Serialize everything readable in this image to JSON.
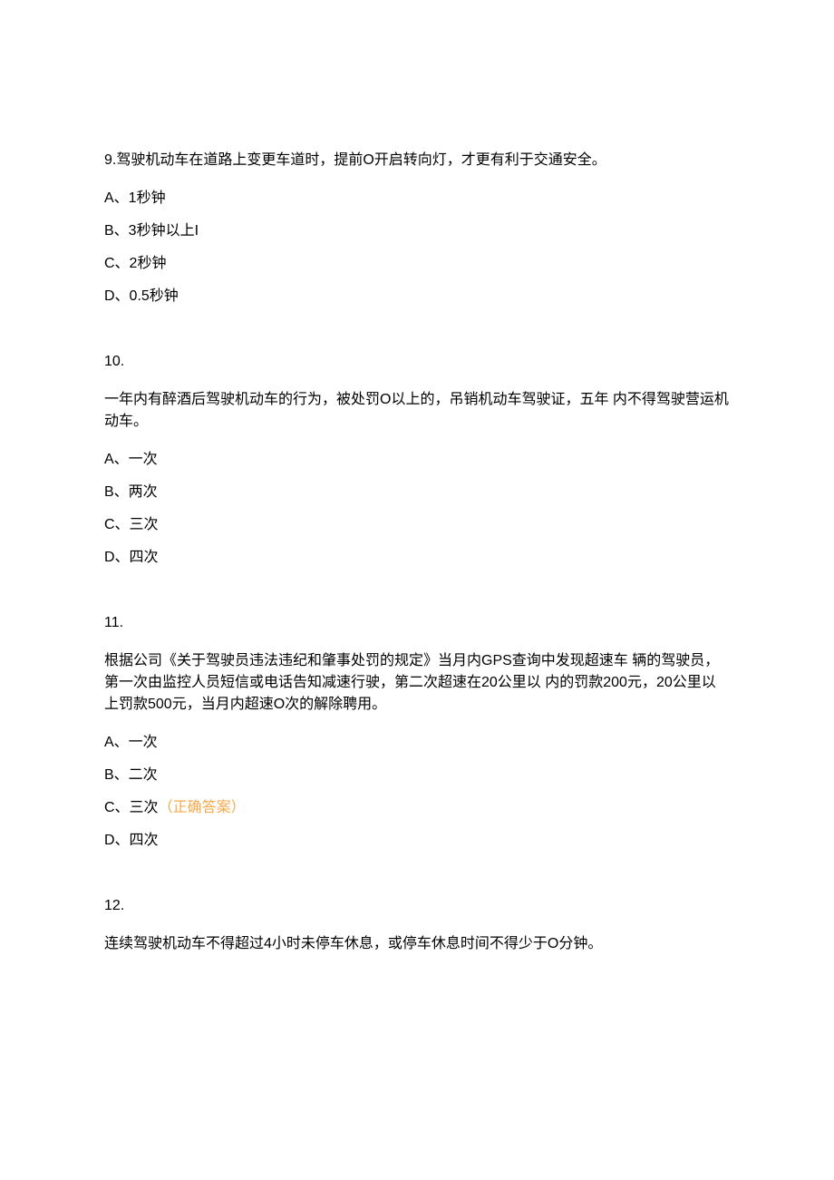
{
  "questions": [
    {
      "number": "9.",
      "text": "驾驶机动车在道路上变更车道时，提前O开启转向灯，才更有利于交通安全。",
      "options": [
        {
          "label": "A、1秒钟",
          "correct": false
        },
        {
          "label": "B、3秒钟以上I",
          "correct": false
        },
        {
          "label": "C、2秒钟",
          "correct": false
        },
        {
          "label": "D、0.5秒钟",
          "correct": false
        }
      ],
      "inline_number": true
    },
    {
      "number": "10.",
      "text": "一年内有醉酒后驾驶机动车的行为，被处罚O以上的，吊销机动车驾驶证，五年 内不得驾驶营运机动车。",
      "options": [
        {
          "label": "A、一次",
          "correct": false
        },
        {
          "label": "B、两次",
          "correct": false
        },
        {
          "label": "C、三次",
          "correct": false
        },
        {
          "label": "D、四次",
          "correct": false
        }
      ],
      "inline_number": false
    },
    {
      "number": "11.",
      "text": "根据公司《关于驾驶员违法违纪和肇事处罚的规定》当月内GPS查询中发现超速车 辆的驾驶员，第一次由监控人员短信或电话告知减速行驶，第二次超速在20公里以 内的罚款200元，20公里以上罚款500元，当月内超速O次的解除聘用。",
      "options": [
        {
          "label": "A、一次",
          "correct": false
        },
        {
          "label": "B、二次",
          "correct": false
        },
        {
          "label": "C、三次",
          "correct": true,
          "correct_label": "（正确答案）"
        },
        {
          "label": "D、四次",
          "correct": false
        }
      ],
      "inline_number": false
    },
    {
      "number": "12.",
      "text": "连续驾驶机动车不得超过4小时未停车休息，或停车休息时间不得少于O分钟。",
      "options": [],
      "inline_number": false
    }
  ]
}
